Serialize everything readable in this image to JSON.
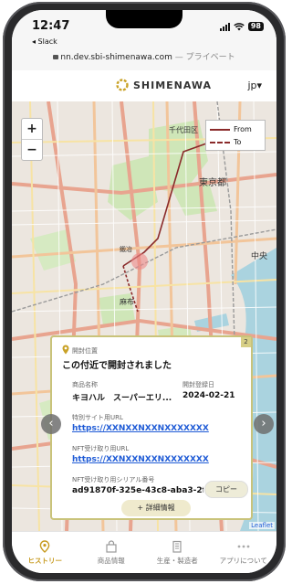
{
  "status": {
    "time": "12:47",
    "back_app": "◂ Slack",
    "battery": "98"
  },
  "browser": {
    "url": "nn.dev.sbi-shimenawa.com",
    "url_suffix": " — プライベート"
  },
  "header": {
    "brand": "SHIMENAWA",
    "language": "jp▾"
  },
  "map": {
    "zoom_in": "+",
    "zoom_out": "−",
    "legend": {
      "from_label": "From",
      "to_label": "To"
    },
    "labels": {
      "chiyoda": "千代田区",
      "tokyo": "東京都",
      "chuo": "中央",
      "azabu": "麻布",
      "kaji": "鍛冶"
    },
    "attribution": "Leaflet",
    "colors": {
      "route": "#8a2a2a",
      "accent": "#c79a1f"
    }
  },
  "card": {
    "index": "2",
    "location_label": "開封位置",
    "location_title": "この付近で開封されました",
    "product_label": "商品名称",
    "product_value": "キヨハル　スーパーエリ...",
    "registered_label": "開封登録日",
    "registered_value": "2024-02-21",
    "site_url_label": "特別サイト用URL",
    "site_url_value": "https://XXNXXNXXNXXXXXXX",
    "nft_url_label": "NFT受け取り用URL",
    "nft_url_value": "https://XXNXXNXXNXXXXXXX",
    "serial_label": "NFT受け取り用シリアル番号",
    "serial_value": "ad91870f-325e-43c8-aba3-2f63...",
    "copy_button": "コピー",
    "detail_button": "+ 詳細情報",
    "prev_arrow": "‹",
    "next_arrow": "›"
  },
  "tabs": [
    {
      "label": "ヒストリー",
      "icon": "location-pin-icon",
      "active": true
    },
    {
      "label": "商品情報",
      "icon": "bag-icon",
      "active": false
    },
    {
      "label": "生産・製造者",
      "icon": "building-icon",
      "active": false
    },
    {
      "label": "アプリについて",
      "icon": "more-dots-icon",
      "active": false
    }
  ]
}
